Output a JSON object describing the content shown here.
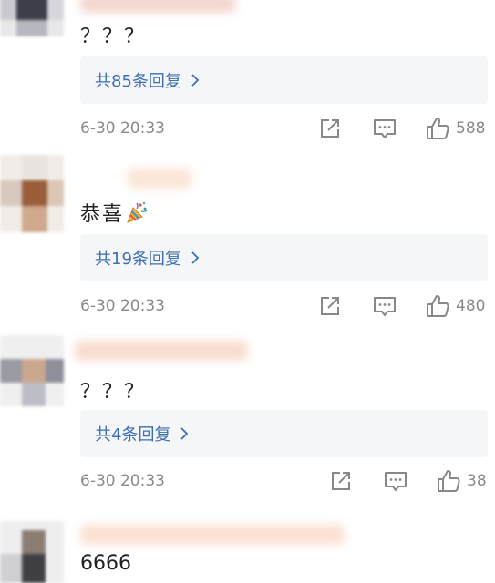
{
  "comments": [
    {
      "text": "？？？",
      "replies_label": "共85条回复",
      "time": "6-30 20:33",
      "like_count": "588",
      "icons": [
        "forward-icon",
        "comment-icon",
        "thumbs-up-icon"
      ]
    },
    {
      "text": "恭喜",
      "emoji": "party-popper-icon",
      "replies_label": "共19条回复",
      "time": "6-30 20:33",
      "like_count": "480",
      "icons": [
        "forward-icon",
        "comment-icon",
        "thumbs-up-icon"
      ]
    },
    {
      "text": "？？？",
      "replies_label": "共4条回复",
      "time": "6-30 20:33",
      "like_count": "38",
      "icons": [
        "forward-icon",
        "comment-icon",
        "thumbs-up-icon"
      ]
    },
    {
      "text": "6666"
    }
  ],
  "colors": {
    "reply_link": "#3c6fb5",
    "reply_bg": "#f5f6f7",
    "meta_gray": "#8a8a8a",
    "icon_gray": "#888888"
  }
}
